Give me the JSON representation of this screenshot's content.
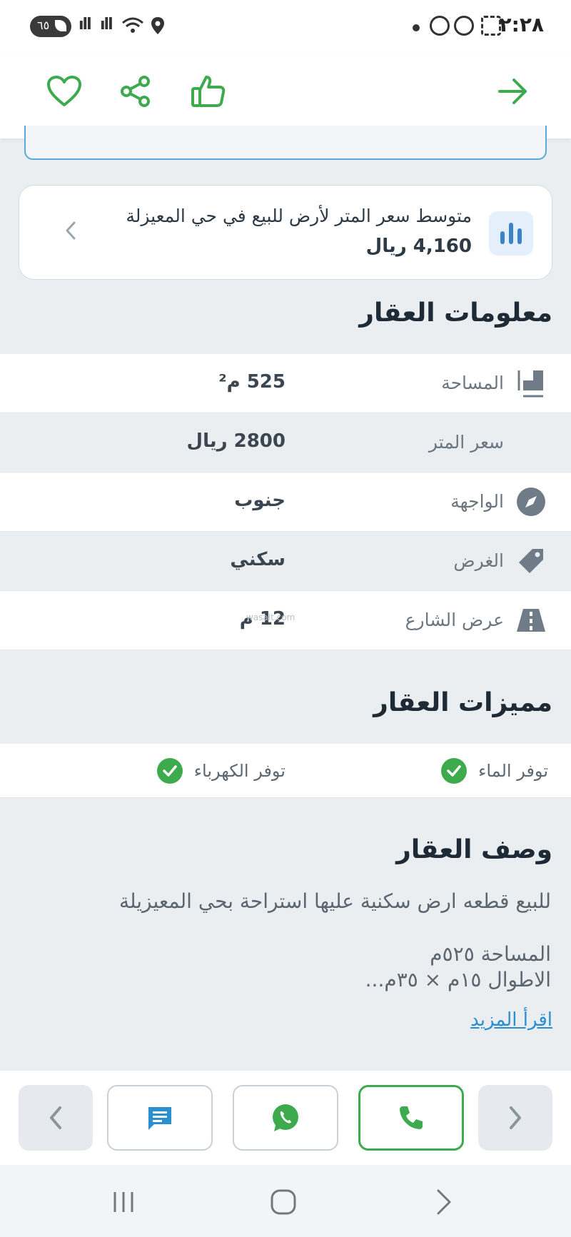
{
  "status_bar": {
    "time": "٢:٢٨",
    "battery": "٦٥",
    "icons": [
      "dot",
      "whatsapp-status-icon",
      "messenger-icon",
      "screenshot-icon",
      "signal-icon",
      "signal-icon",
      "wifi-icon",
      "location-icon"
    ]
  },
  "topbar": {
    "icons": [
      "favorite-heart-icon",
      "share-icon",
      "thumbs-up-icon",
      "back-arrow-icon"
    ],
    "accent": "#3dab4d"
  },
  "avg_price_card": {
    "title": "متوسط سعر المتر لأرض للبيع في حي المعيزلة",
    "price": "4,160 ريال",
    "icon": "bar-chart-icon"
  },
  "property_info": {
    "title": "معلومات العقار",
    "rows": [
      {
        "label": "المساحة",
        "value": "525 م²",
        "icon": "area-measure-icon"
      },
      {
        "label": "سعر المتر",
        "value": "2800 ريال",
        "icon": ""
      },
      {
        "label": "الواجهة",
        "value": "جنوب",
        "icon": "compass-icon"
      },
      {
        "label": "الغرض",
        "value": "سكني",
        "icon": "tag-icon"
      },
      {
        "label": "عرض الشارع",
        "value": "12 م",
        "icon": "road-icon"
      }
    ],
    "watermark": "wasalt.com"
  },
  "features": {
    "title": "مميزات العقار",
    "items": [
      "توفر الماء",
      "توفر الكهرباء"
    ]
  },
  "description": {
    "title": "وصف العقار",
    "line1": "للبيع قطعه ارض سكنية عليها استراحة بحي المعيزيلة",
    "line2": "المساحة ٥٢٥م",
    "line3": "الاطوال ١٥م × ٣٥م...",
    "read_more": "اقرأ المزيد"
  },
  "action_bar": {
    "buttons": [
      "chevron-left-icon",
      "chat-icon",
      "whatsapp-icon",
      "phone-icon",
      "chevron-right-icon"
    ],
    "colors": {
      "call": "#3dab4d",
      "whatsapp": "#3dab4d",
      "chat": "#2a8fd0"
    }
  },
  "system_nav": [
    "recent-apps-icon",
    "home-icon",
    "back-icon"
  ]
}
